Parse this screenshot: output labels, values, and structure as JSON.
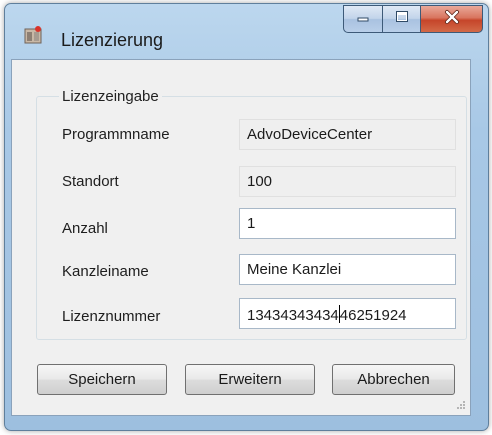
{
  "window": {
    "title": "Lizenzierung",
    "app_icon": "license-app-icon",
    "caption": {
      "minimize_icon": "minimize-icon",
      "maximize_icon": "maximize-icon",
      "close_icon": "close-icon"
    }
  },
  "group": {
    "title": "Lizenzeingabe"
  },
  "fields": {
    "programmname": {
      "label": "Programmname",
      "value": "AdvoDeviceCenter"
    },
    "standort": {
      "label": "Standort",
      "value": "100"
    },
    "anzahl": {
      "label": "Anzahl",
      "value": "1"
    },
    "kanzleiname": {
      "label": "Kanzleiname",
      "value": "Meine Kanzlei"
    },
    "lizenznummer": {
      "label": "Lizenznummer",
      "value_before_caret": "13434343434",
      "value_after_caret": "46251924"
    }
  },
  "buttons": {
    "save": "Speichern",
    "extend": "Erweitern",
    "cancel": "Abbrechen"
  },
  "colors": {
    "frame": "#a8c8e6",
    "close_button": "#c6452a",
    "dialog_background": "#f0f0f0"
  }
}
